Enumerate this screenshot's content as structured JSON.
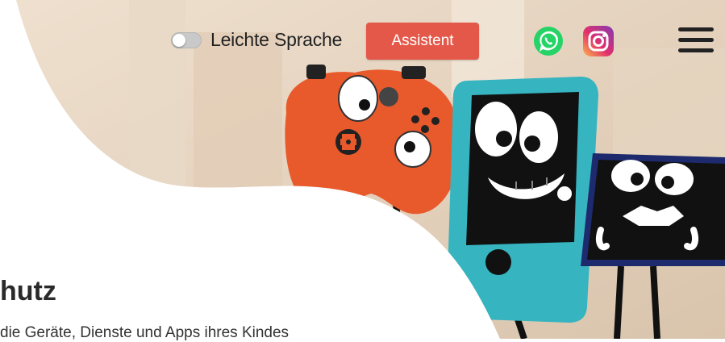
{
  "header": {
    "toggle_label": "Leichte Sprache",
    "assistant_button": "Assistent",
    "social": [
      "whatsapp-icon",
      "instagram-icon"
    ],
    "menu": "hamburger-menu-icon"
  },
  "hero": {
    "heading": "hutz",
    "subtext": "die Geräte, Dienste und Apps ihres Kindes"
  },
  "colors": {
    "accent": "#e45849",
    "whatsapp": "#25d366",
    "text": "#222222"
  }
}
